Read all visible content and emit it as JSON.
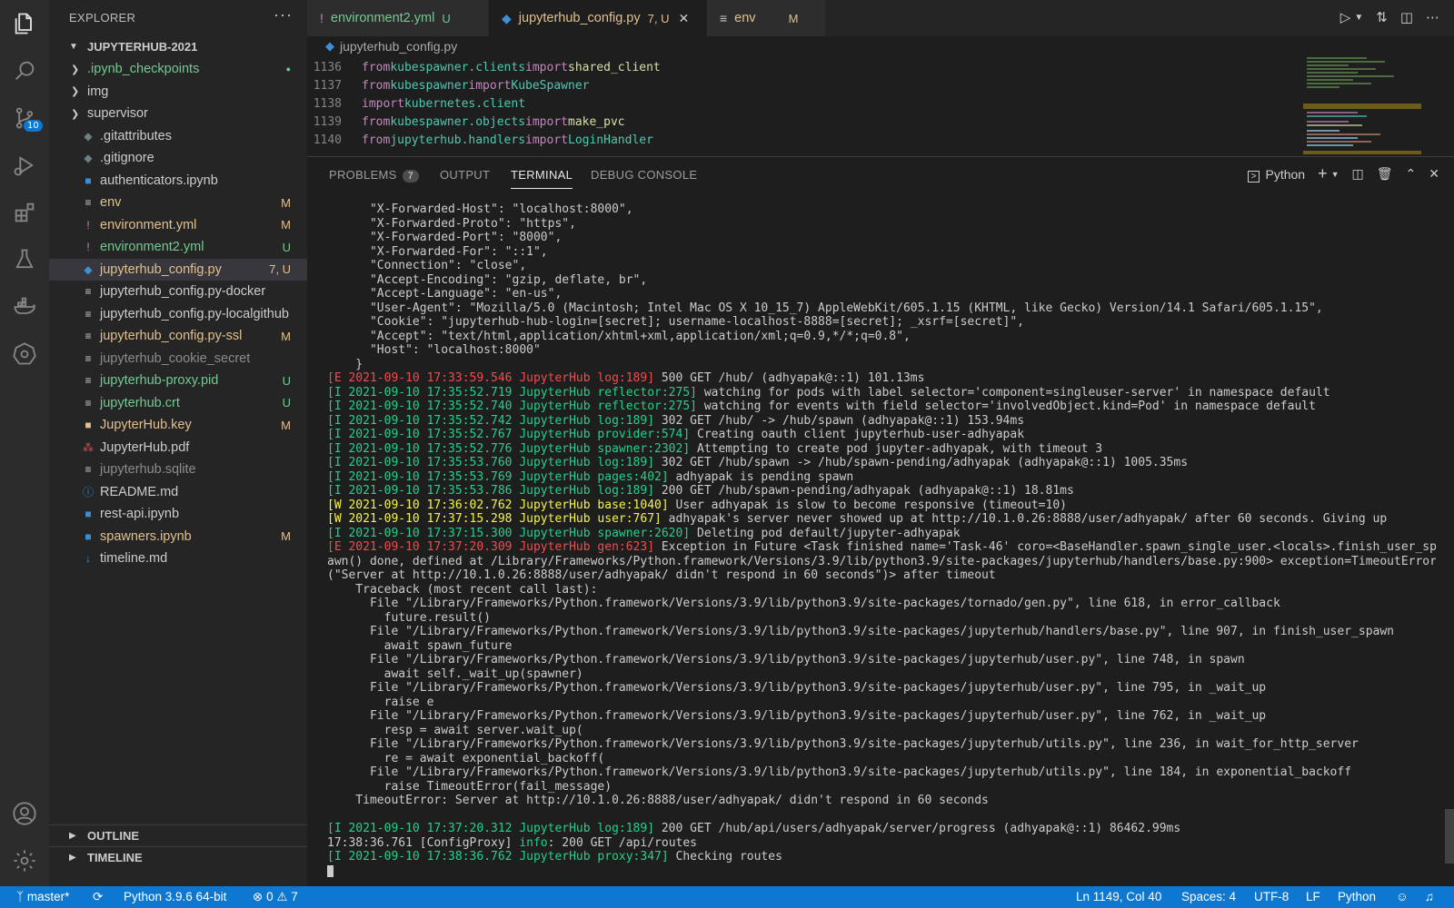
{
  "activity": {
    "scm_badge": "10"
  },
  "sidebar": {
    "title": "EXPLORER",
    "more": "···",
    "folder": "JUPYTERHUB-2021",
    "items": [
      {
        "name": ".ipynb_checkpoints",
        "type": "folder",
        "color": "#73c991",
        "status": "●",
        "status_color": "#73c991"
      },
      {
        "name": "img",
        "type": "folder",
        "color": "#cccccc",
        "status": ""
      },
      {
        "name": "supervisor",
        "type": "folder",
        "color": "#cccccc",
        "status": ""
      },
      {
        "name": ".gitattributes",
        "type": "git",
        "color": "#cccccc",
        "status": ""
      },
      {
        "name": ".gitignore",
        "type": "git",
        "color": "#cccccc",
        "status": ""
      },
      {
        "name": "authenticators.ipynb",
        "type": "notebook",
        "color": "#cccccc",
        "status": ""
      },
      {
        "name": "env",
        "type": "lines",
        "color": "#e2c08d",
        "status": "M",
        "status_color": "#e2c08d"
      },
      {
        "name": "environment.yml",
        "type": "yaml",
        "color": "#e2c08d",
        "status": "M",
        "status_color": "#e2c08d"
      },
      {
        "name": "environment2.yml",
        "type": "yaml",
        "color": "#73c991",
        "status": "U",
        "status_color": "#73c991"
      },
      {
        "name": "jupyterhub_config.py",
        "type": "python",
        "color": "#e2c08d",
        "status": "7, U",
        "status_color": "#e2c08d",
        "selected": true
      },
      {
        "name": "jupyterhub_config.py-docker",
        "type": "lines",
        "color": "#cccccc",
        "status": ""
      },
      {
        "name": "jupyterhub_config.py-localgithub",
        "type": "lines",
        "color": "#cccccc",
        "status": ""
      },
      {
        "name": "jupyterhub_config.py-ssl",
        "type": "lines",
        "color": "#e2c08d",
        "status": "M",
        "status_color": "#e2c08d"
      },
      {
        "name": "jupyterhub_cookie_secret",
        "type": "lines",
        "color": "#8c8c8c",
        "status": ""
      },
      {
        "name": "jupyterhub-proxy.pid",
        "type": "lines",
        "color": "#73c991",
        "status": "U",
        "status_color": "#73c991"
      },
      {
        "name": "jupyterhub.crt",
        "type": "lines",
        "color": "#73c991",
        "status": "U",
        "status_color": "#73c991"
      },
      {
        "name": "JupyterHub.key",
        "type": "lock",
        "color": "#e2c08d",
        "status": "M",
        "status_color": "#e2c08d"
      },
      {
        "name": "JupyterHub.pdf",
        "type": "pdf",
        "color": "#cccccc",
        "status": ""
      },
      {
        "name": "jupyterhub.sqlite",
        "type": "lines",
        "color": "#8c8c8c",
        "status": ""
      },
      {
        "name": "README.md",
        "type": "info",
        "color": "#cccccc",
        "status": ""
      },
      {
        "name": "rest-api.ipynb",
        "type": "notebook",
        "color": "#cccccc",
        "status": ""
      },
      {
        "name": "spawners.ipynb",
        "type": "notebook",
        "color": "#e2c08d",
        "status": "M",
        "status_color": "#e2c08d"
      },
      {
        "name": "timeline.md",
        "type": "markdown",
        "color": "#cccccc",
        "status": ""
      }
    ],
    "outline": "OUTLINE",
    "timeline": "TIMELINE"
  },
  "tabs": [
    {
      "icon": "!",
      "icon_color": "#c586c0",
      "label": "environment2.yml",
      "badge": "U",
      "color": "#73c991"
    },
    {
      "icon": "◆",
      "icon_color": "#3c8fd6",
      "label": "jupyterhub_config.py",
      "badge": "7, U",
      "color": "#e2c08d"
    },
    {
      "icon": "≡",
      "icon_color": "#cccccc",
      "label": "env",
      "badge": "M",
      "color": "#e2c08d"
    }
  ],
  "breadcrumb": "jupyterhub_config.py",
  "editor": {
    "lines": [
      {
        "n": "1136",
        "a": "from",
        "b": "kubespawner.clients",
        "c": "import",
        "d": "shared_client",
        "dtype": "name"
      },
      {
        "n": "1137",
        "a": "from",
        "b": "kubespawner",
        "c": "import",
        "d": "KubeSpawner",
        "dtype": "cls"
      },
      {
        "n": "1138",
        "a": "import",
        "b": "kubernetes.client",
        "c": "",
        "d": "",
        "dtype": "name"
      },
      {
        "n": "1139",
        "a": "from",
        "b": "kubespawner.objects",
        "c": "import",
        "d": "make_pvc",
        "dtype": "name"
      },
      {
        "n": "1140",
        "a": "from",
        "b": "jupyterhub.handlers",
        "c": "import",
        "d": "LoginHandler",
        "dtype": "cls"
      }
    ]
  },
  "panel": {
    "tabs": {
      "problems": "PROBLEMS",
      "problems_count": "7",
      "output": "OUTPUT",
      "terminal": "TERMINAL",
      "debug": "DEBUG CONSOLE"
    },
    "shell": "Python"
  },
  "terminal": [
    {
      "t": "      \"X-Forwarded-Host\": \"localhost:8000\","
    },
    {
      "t": "      \"X-Forwarded-Proto\": \"https\","
    },
    {
      "t": "      \"X-Forwarded-Port\": \"8000\","
    },
    {
      "t": "      \"X-Forwarded-For\": \"::1\","
    },
    {
      "t": "      \"Connection\": \"close\","
    },
    {
      "t": "      \"Accept-Encoding\": \"gzip, deflate, br\","
    },
    {
      "t": "      \"Accept-Language\": \"en-us\","
    },
    {
      "t": "      \"User-Agent\": \"Mozilla/5.0 (Macintosh; Intel Mac OS X 10_15_7) AppleWebKit/605.1.15 (KHTML, like Gecko) Version/14.1 Safari/605.1.15\","
    },
    {
      "t": "      \"Cookie\": \"jupyterhub-hub-login=[secret]; username-localhost-8888=[secret]; _xsrf=[secret]\","
    },
    {
      "t": "      \"Accept\": \"text/html,application/xhtml+xml,application/xml;q=0.9,*/*;q=0.8\","
    },
    {
      "t": "      \"Host\": \"localhost:8000\""
    },
    {
      "t": "    }"
    },
    {
      "p": "[E 2021-09-10 17:33:59.546 JupyterHub log:189]",
      "l": "e",
      "t": " 500 GET /hub/ (adhyapak@::1) 101.13ms"
    },
    {
      "p": "[I 2021-09-10 17:35:52.719 JupyterHub reflector:275]",
      "l": "i",
      "t": " watching for pods with label selector='component=singleuser-server' in namespace default"
    },
    {
      "p": "[I 2021-09-10 17:35:52.740 JupyterHub reflector:275]",
      "l": "i",
      "t": " watching for events with field selector='involvedObject.kind=Pod' in namespace default"
    },
    {
      "p": "[I 2021-09-10 17:35:52.742 JupyterHub log:189]",
      "l": "i",
      "t": " 302 GET /hub/ -> /hub/spawn (adhyapak@::1) 153.94ms"
    },
    {
      "p": "[I 2021-09-10 17:35:52.767 JupyterHub provider:574]",
      "l": "i",
      "t": " Creating oauth client jupyterhub-user-adhyapak"
    },
    {
      "p": "[I 2021-09-10 17:35:52.776 JupyterHub spawner:2302]",
      "l": "i",
      "t": " Attempting to create pod jupyter-adhyapak, with timeout 3"
    },
    {
      "p": "[I 2021-09-10 17:35:53.760 JupyterHub log:189]",
      "l": "i",
      "t": " 302 GET /hub/spawn -> /hub/spawn-pending/adhyapak (adhyapak@::1) 1005.35ms"
    },
    {
      "p": "[I 2021-09-10 17:35:53.769 JupyterHub pages:402]",
      "l": "i",
      "t": " adhyapak is pending spawn"
    },
    {
      "p": "[I 2021-09-10 17:35:53.786 JupyterHub log:189]",
      "l": "i",
      "t": " 200 GET /hub/spawn-pending/adhyapak (adhyapak@::1) 18.81ms"
    },
    {
      "p": "[W 2021-09-10 17:36:02.762 JupyterHub base:1040]",
      "l": "w",
      "t": " User adhyapak is slow to become responsive (timeout=10)"
    },
    {
      "p": "[W 2021-09-10 17:37:15.298 JupyterHub user:767]",
      "l": "w",
      "t": " adhyapak's server never showed up at http://10.1.0.26:8888/user/adhyapak/ after 60 seconds. Giving up"
    },
    {
      "p": "[I 2021-09-10 17:37:15.300 JupyterHub spawner:2620]",
      "l": "i",
      "t": " Deleting pod default/jupyter-adhyapak"
    },
    {
      "p": "[E 2021-09-10 17:37:20.309 JupyterHub gen:623]",
      "l": "e",
      "t": " Exception in Future <Task finished name='Task-46' coro=<BaseHandler.spawn_single_user.<locals>.finish_user_sp"
    },
    {
      "t": "awn() done, defined at /Library/Frameworks/Python.framework/Versions/3.9/lib/python3.9/site-packages/jupyterhub/handlers/base.py:900> exception=TimeoutError"
    },
    {
      "t": "(\"Server at http://10.1.0.26:8888/user/adhyapak/ didn't respond in 60 seconds\")> after timeout"
    },
    {
      "t": "    Traceback (most recent call last):"
    },
    {
      "t": "      File \"/Library/Frameworks/Python.framework/Versions/3.9/lib/python3.9/site-packages/tornado/gen.py\", line 618, in error_callback"
    },
    {
      "t": "        future.result()"
    },
    {
      "t": "      File \"/Library/Frameworks/Python.framework/Versions/3.9/lib/python3.9/site-packages/jupyterhub/handlers/base.py\", line 907, in finish_user_spawn"
    },
    {
      "t": "        await spawn_future"
    },
    {
      "t": "      File \"/Library/Frameworks/Python.framework/Versions/3.9/lib/python3.9/site-packages/jupyterhub/user.py\", line 748, in spawn"
    },
    {
      "t": "        await self._wait_up(spawner)"
    },
    {
      "t": "      File \"/Library/Frameworks/Python.framework/Versions/3.9/lib/python3.9/site-packages/jupyterhub/user.py\", line 795, in _wait_up"
    },
    {
      "t": "        raise e"
    },
    {
      "t": "      File \"/Library/Frameworks/Python.framework/Versions/3.9/lib/python3.9/site-packages/jupyterhub/user.py\", line 762, in _wait_up"
    },
    {
      "t": "        resp = await server.wait_up("
    },
    {
      "t": "      File \"/Library/Frameworks/Python.framework/Versions/3.9/lib/python3.9/site-packages/jupyterhub/utils.py\", line 236, in wait_for_http_server"
    },
    {
      "t": "        re = await exponential_backoff("
    },
    {
      "t": "      File \"/Library/Frameworks/Python.framework/Versions/3.9/lib/python3.9/site-packages/jupyterhub/utils.py\", line 184, in exponential_backoff"
    },
    {
      "t": "        raise TimeoutError(fail_message)"
    },
    {
      "t": "    TimeoutError: Server at http://10.1.0.26:8888/user/adhyapak/ didn't respond in 60 seconds"
    },
    {
      "t": ""
    },
    {
      "p": "[I 2021-09-10 17:37:20.312 JupyterHub log:189]",
      "l": "i",
      "t": " 200 GET /hub/api/users/adhyapak/server/progress (adhyapak@::1) 86462.99ms"
    },
    {
      "t": "17:38:36.761 [ConfigProxy] ",
      "info": "info",
      "t2": ": 200 GET /api/routes"
    },
    {
      "p": "[I 2021-09-10 17:38:36.762 JupyterHub proxy:347]",
      "l": "i",
      "t": " Checking routes"
    }
  ],
  "status": {
    "branch": "master*",
    "interpreter": "Python 3.9.6 64-bit",
    "errors": "0",
    "warnings": "7",
    "position": "Ln 1149, Col 40",
    "spaces": "Spaces: 4",
    "encoding": "UTF-8",
    "eol": "LF",
    "language": "Python"
  }
}
